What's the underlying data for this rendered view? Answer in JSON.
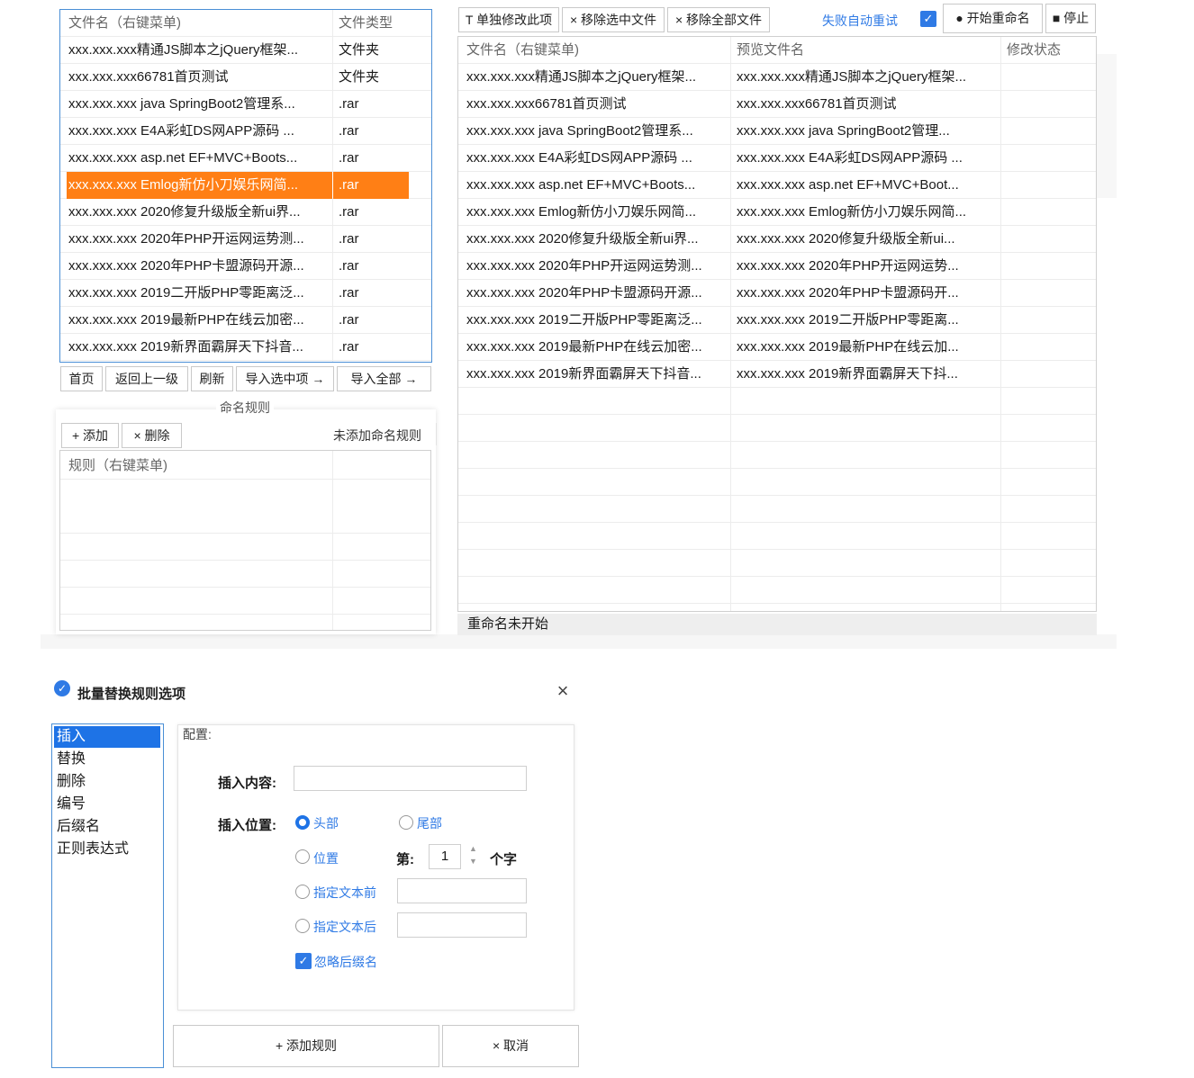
{
  "left_panel": {
    "columns": [
      "文件名（右键菜单)",
      "文件类型"
    ],
    "rows": [
      {
        "name": "xxx.xxx.xxx精通JS脚本之jQuery框架...",
        "type": "文件夹"
      },
      {
        "name": "xxx.xxx.xxx66781首页测试",
        "type": "文件夹"
      },
      {
        "name": "xxx.xxx.xxx java SpringBoot2管理系...",
        "type": ".rar"
      },
      {
        "name": "xxx.xxx.xxx E4A彩虹DS网APP源码 ...",
        "type": ".rar"
      },
      {
        "name": "xxx.xxx.xxx asp.net EF+MVC+Boots...",
        "type": ".rar"
      },
      {
        "name": "xxx.xxx.xxx Emlog新仿小刀娱乐网简...",
        "type": ".rar",
        "selected": true
      },
      {
        "name": "xxx.xxx.xxx 2020修复升级版全新ui界...",
        "type": ".rar"
      },
      {
        "name": "xxx.xxx.xxx 2020年PHP开运网运势测...",
        "type": ".rar"
      },
      {
        "name": "xxx.xxx.xxx 2020年PHP卡盟源码开源...",
        "type": ".rar"
      },
      {
        "name": "xxx.xxx.xxx 2019二开版PHP零距离泛...",
        "type": ".rar"
      },
      {
        "name": "xxx.xxx.xxx 2019最新PHP在线云加密...",
        "type": ".rar"
      },
      {
        "name": "xxx.xxx.xxx 2019新界面霸屏天下抖音...",
        "type": ".rar"
      }
    ],
    "nav_buttons": {
      "home": "首页",
      "back": "返回上一级",
      "refresh": "刷新",
      "import_selected": "导入选中项 →",
      "import_all": "导入全部 →"
    }
  },
  "rules_panel": {
    "title": "命名规则",
    "add_label": "+ 添加",
    "delete_label": "× 删除",
    "status": "未添加命名规则",
    "list_header": "规则（右键菜单)"
  },
  "toolbar": {
    "edit_single": "T 单独修改此项",
    "remove_selected": "× 移除选中文件",
    "remove_all": "× 移除全部文件",
    "auto_retry": "失败自动重试",
    "start": "● 开始重命名",
    "stop": "■ 停止"
  },
  "right_panel": {
    "columns": [
      "文件名（右键菜单)",
      "预览文件名",
      "修改状态"
    ],
    "rows": [
      {
        "name": "xxx.xxx.xxx精通JS脚本之jQuery框架...",
        "preview": "xxx.xxx.xxx精通JS脚本之jQuery框架...",
        "status": ""
      },
      {
        "name": "xxx.xxx.xxx66781首页测试",
        "preview": "xxx.xxx.xxx66781首页测试",
        "status": ""
      },
      {
        "name": "xxx.xxx.xxx java SpringBoot2管理系...",
        "preview": "xxx.xxx.xxx java SpringBoot2管理...",
        "status": ""
      },
      {
        "name": "xxx.xxx.xxx E4A彩虹DS网APP源码 ...",
        "preview": "xxx.xxx.xxx E4A彩虹DS网APP源码 ...",
        "status": ""
      },
      {
        "name": "xxx.xxx.xxx asp.net EF+MVC+Boots...",
        "preview": "xxx.xxx.xxx asp.net EF+MVC+Boot...",
        "status": ""
      },
      {
        "name": "xxx.xxx.xxx Emlog新仿小刀娱乐网简...",
        "preview": "xxx.xxx.xxx Emlog新仿小刀娱乐网简...",
        "status": ""
      },
      {
        "name": "xxx.xxx.xxx 2020修复升级版全新ui界...",
        "preview": "xxx.xxx.xxx 2020修复升级版全新ui...",
        "status": ""
      },
      {
        "name": "xxx.xxx.xxx 2020年PHP开运网运势测...",
        "preview": "xxx.xxx.xxx 2020年PHP开运网运势...",
        "status": ""
      },
      {
        "name": "xxx.xxx.xxx 2020年PHP卡盟源码开源...",
        "preview": "xxx.xxx.xxx 2020年PHP卡盟源码开...",
        "status": ""
      },
      {
        "name": "xxx.xxx.xxx 2019二开版PHP零距离泛...",
        "preview": "xxx.xxx.xxx 2019二开版PHP零距离...",
        "status": ""
      },
      {
        "name": "xxx.xxx.xxx 2019最新PHP在线云加密...",
        "preview": "xxx.xxx.xxx 2019最新PHP在线云加...",
        "status": ""
      },
      {
        "name": "xxx.xxx.xxx 2019新界面霸屏天下抖音...",
        "preview": "xxx.xxx.xxx 2019新界面霸屏天下抖...",
        "status": ""
      }
    ],
    "status_bar": "重命名未开始"
  },
  "dialog": {
    "title": "批量替换规则选项",
    "close_icon": "close-icon",
    "rule_types": [
      "插入",
      "替换",
      "删除",
      "编号",
      "后缀名",
      "正则表达式"
    ],
    "selected_rule_type": "插入",
    "config_label": "配置:",
    "insert_content_label": "插入内容:",
    "insert_content_value": "",
    "insert_position_label": "插入位置:",
    "options": {
      "head": "头部",
      "tail": "尾部",
      "position": "位置",
      "before_text": "指定文本前",
      "after_text": "指定文本后"
    },
    "selected_position": "头部",
    "nth_label": "第:",
    "nth_value": "1",
    "char_unit": "个字",
    "before_text_value": "",
    "after_text_value": "",
    "ignore_ext_label": "忽略后缀名",
    "ignore_ext_checked": true,
    "add_button": "+ 添加规则",
    "cancel_button": "× 取消"
  },
  "colors": {
    "accent": "#2f7ae5",
    "selection": "#ff7f15",
    "border_focus": "#4a8fd6"
  }
}
